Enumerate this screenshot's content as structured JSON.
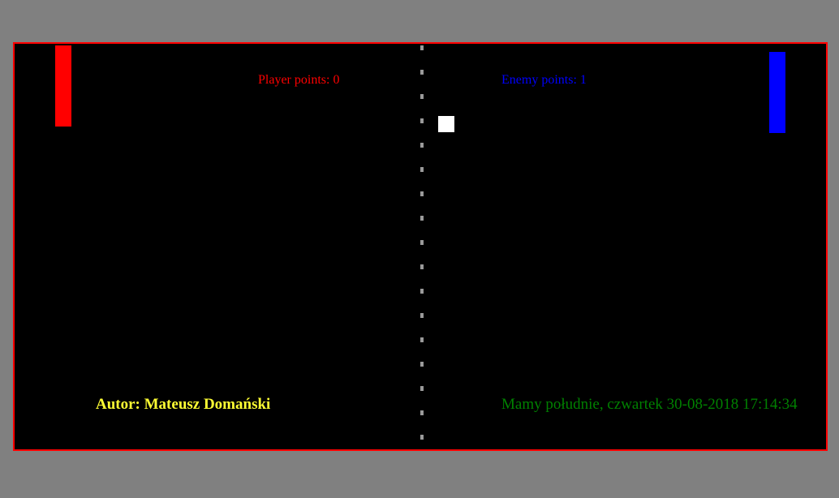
{
  "colors": {
    "page_background": "#808080",
    "board_background": "#000000",
    "board_border": "#ff0000",
    "center_line": "#9a9a9a",
    "player": "#ff0000",
    "enemy": "#0000ff",
    "ball": "#ffffff",
    "author": "#ffff33",
    "datetime": "#008000"
  },
  "scoreboard": {
    "player_label": "Player points: 0",
    "enemy_label": "Enemy points: 1"
  },
  "footer": {
    "author": "Autor: Mateusz Domański",
    "datetime": "Mamy południe, czwartek 30-08-2018 17:14:34"
  }
}
